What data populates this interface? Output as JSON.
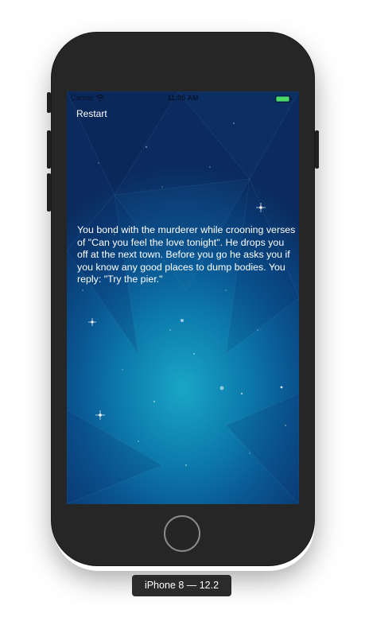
{
  "status_bar": {
    "carrier": "Carrier",
    "time": "11:05 AM",
    "wifi_icon": "wifi-icon",
    "battery_icon": "battery-icon",
    "battery_color": "#4cd964"
  },
  "nav": {
    "restart_label": "Restart"
  },
  "story": {
    "text": "You bond with the murderer while crooning verses of \"Can you feel the love tonight\". He drops you off at the next town. Before you go he asks you if you know any good places to dump bodies. You reply: \"Try the pier.\""
  },
  "device": {
    "label": "iPhone 8 — 12.2",
    "home_button_icon": "home-button"
  },
  "colors": {
    "background_deep": "#0b2b5e",
    "background_glow": "#1aa6c8",
    "text": "#ffffff",
    "phone_body": "#262626"
  }
}
